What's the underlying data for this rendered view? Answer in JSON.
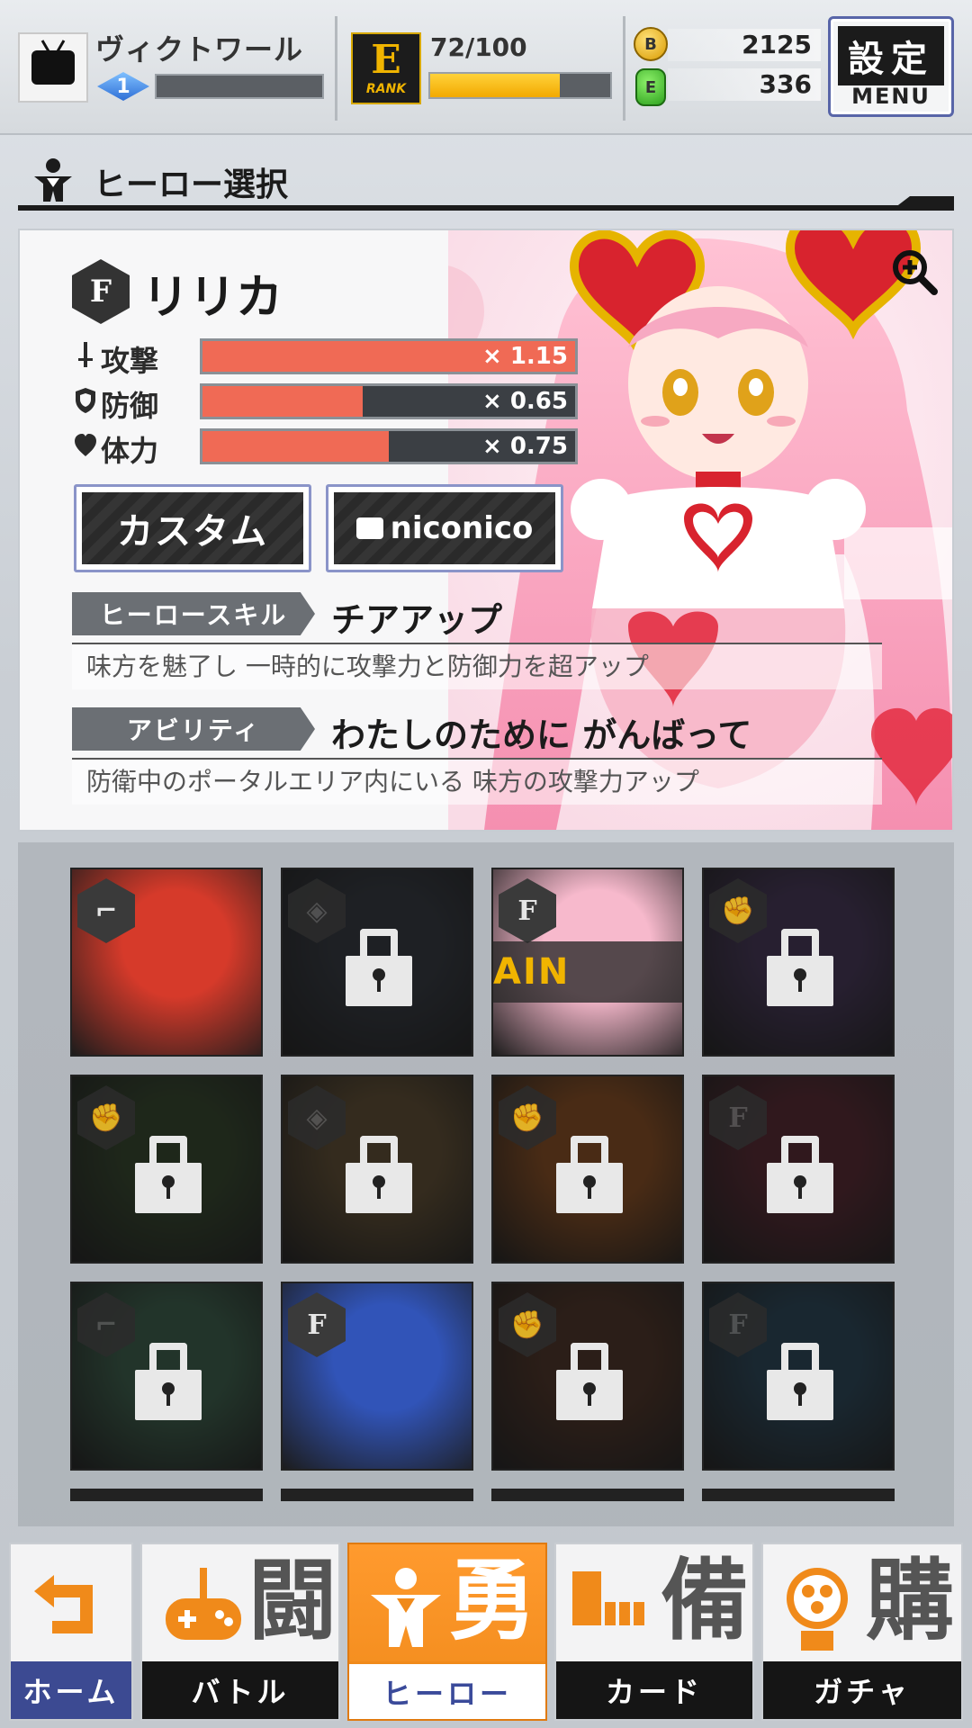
{
  "header": {
    "player_name": "ヴィクトワール",
    "level": "1",
    "rank_letter": "E",
    "rank_word": "RANK",
    "rank_progress_text": "72/100",
    "rank_progress": 0.72,
    "gold_coin_symbol": "B",
    "gold_coins": "2125",
    "green_currency_symbol": "E",
    "green_currency": "336",
    "menu_kanji": "設定",
    "menu_label": "MENU"
  },
  "section": {
    "title": "ヒーロー選択"
  },
  "hero": {
    "name": "リリカ",
    "type_glyph": "F",
    "stats": [
      {
        "label": "攻撃",
        "icon": "sword-icon",
        "value": "× 1.15",
        "fill": 1.0
      },
      {
        "label": "防御",
        "icon": "shield-icon",
        "value": "× 0.65",
        "fill": 0.43
      },
      {
        "label": "体力",
        "icon": "heart-icon",
        "value": "× 0.75",
        "fill": 0.5
      }
    ],
    "custom_button": "カスタム",
    "niconico_button": "niconico",
    "skill_tag": "ヒーロースキル",
    "skill_name": "チアアップ",
    "skill_desc": "味方を魅了し 一時的に攻撃力と防御力を超アップ",
    "ability_tag": "アビリティ",
    "ability_name": "わたしのために がんばって",
    "ability_desc": "防衛中のポータルエリア内にいる 味方の攻撃力アップ"
  },
  "roster": {
    "selected_banner": "AIN",
    "cards": [
      {
        "type": "boot",
        "locked": false,
        "color": "#d63a2a"
      },
      {
        "type": "shield",
        "locked": true,
        "color": "#3a4250"
      },
      {
        "type": "gun",
        "locked": false,
        "color": "#f7b9cc",
        "selected": true
      },
      {
        "type": "fist",
        "locked": true,
        "color": "#5a3f7a"
      },
      {
        "type": "fist",
        "locked": true,
        "color": "#3b5a2e"
      },
      {
        "type": "shield",
        "locked": true,
        "color": "#8a6a3a"
      },
      {
        "type": "fist",
        "locked": true,
        "color": "#d56a1a"
      },
      {
        "type": "gun",
        "locked": true,
        "color": "#7a2638"
      },
      {
        "type": "boot",
        "locked": true,
        "color": "#4a8a66"
      },
      {
        "type": "gun",
        "locked": false,
        "color": "#3154b8"
      },
      {
        "type": "fist",
        "locked": true,
        "color": "#6a3a24"
      },
      {
        "type": "gun",
        "locked": true,
        "color": "#2a5a7a"
      }
    ]
  },
  "nav": {
    "tabs": [
      {
        "id": "home",
        "kanji": "",
        "label": "ホーム"
      },
      {
        "id": "battle",
        "kanji": "闘",
        "label": "バトル"
      },
      {
        "id": "hero",
        "kanji": "勇",
        "label": "ヒーロー",
        "active": true
      },
      {
        "id": "card",
        "kanji": "備",
        "label": "カード"
      },
      {
        "id": "gacha",
        "kanji": "購",
        "label": "ガチャ"
      }
    ]
  },
  "colors": {
    "accent": "#f08a1a",
    "stat_fill": "#f06a55",
    "rank_gold": "#f0b400",
    "nav_home": "#3c4a92"
  }
}
